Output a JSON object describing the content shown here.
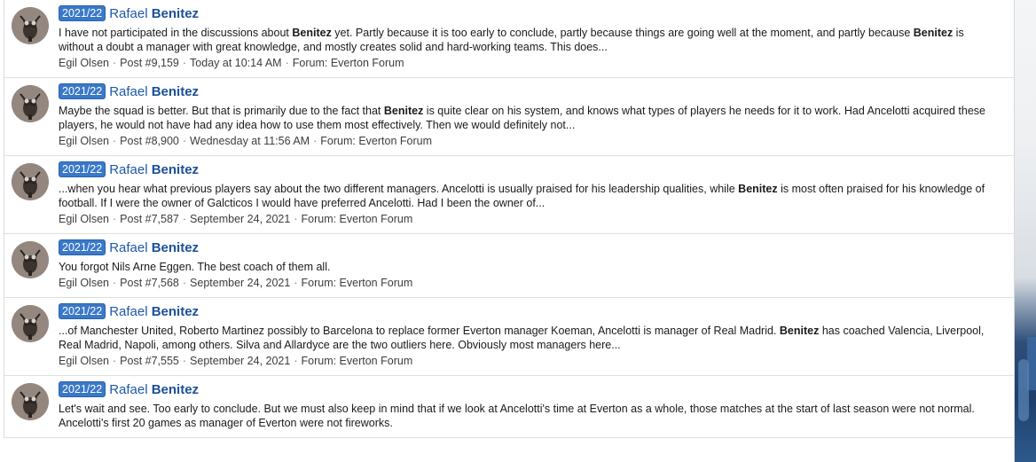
{
  "results": [
    {
      "prefix": "2021/22",
      "thread_plain": "Rafael ",
      "thread_bold": "Benitez",
      "snippet_parts": [
        {
          "t": "I have not participated in the discussions about "
        },
        {
          "b": "Benitez"
        },
        {
          "t": " yet. Partly because it is too early to conclude, partly because things are going well at the moment, and partly because "
        },
        {
          "b": "Benitez"
        },
        {
          "t": " is without a doubt a manager with great knowledge, and mostly creates solid and hard-working teams. This does..."
        }
      ],
      "author": "Egil Olsen",
      "post": "Post #9,159",
      "date": "Today at 10:14 AM",
      "forum": "Forum: Everton Forum"
    },
    {
      "prefix": "2021/22",
      "thread_plain": "Rafael ",
      "thread_bold": "Benitez",
      "snippet_parts": [
        {
          "t": "Maybe the squad is better. But that is primarily due to the fact that "
        },
        {
          "b": "Benitez"
        },
        {
          "t": " is quite clear on his system, and knows what types of players he needs for it to work. Had Ancelotti acquired these players, he would not have had any idea how to use them most effectively. Then we would definitely not..."
        }
      ],
      "author": "Egil Olsen",
      "post": "Post #8,900",
      "date": "Wednesday at 11:56 AM",
      "forum": "Forum: Everton Forum"
    },
    {
      "prefix": "2021/22",
      "thread_plain": "Rafael ",
      "thread_bold": "Benitez",
      "snippet_parts": [
        {
          "t": "...when you hear what previous players say about the two different managers. Ancelotti is usually praised for his leadership qualities, while "
        },
        {
          "b": "Benitez"
        },
        {
          "t": " is most often praised for his knowledge of football. If I were the owner of Galcticos I would have preferred Ancelotti. Had I been the owner of..."
        }
      ],
      "author": "Egil Olsen",
      "post": "Post #7,587",
      "date": "September 24, 2021",
      "forum": "Forum: Everton Forum"
    },
    {
      "prefix": "2021/22",
      "thread_plain": "Rafael ",
      "thread_bold": "Benitez",
      "snippet_parts": [
        {
          "t": "You forgot Nils Arne Eggen. The best coach of them all."
        }
      ],
      "author": "Egil Olsen",
      "post": "Post #7,568",
      "date": "September 24, 2021",
      "forum": "Forum: Everton Forum"
    },
    {
      "prefix": "2021/22",
      "thread_plain": "Rafael ",
      "thread_bold": "Benitez",
      "snippet_parts": [
        {
          "t": "...of Manchester United, Roberto Martinez possibly to Barcelona to replace former Everton manager Koeman, Ancelotti is manager of Real Madrid. "
        },
        {
          "b": "Benitez"
        },
        {
          "t": " has coached Valencia, Liverpool, Real Madrid, Napoli, among others. Silva and Allardyce are the two outliers here. Obviously most managers here..."
        }
      ],
      "author": "Egil Olsen",
      "post": "Post #7,555",
      "date": "September 24, 2021",
      "forum": "Forum: Everton Forum"
    },
    {
      "prefix": "2021/22",
      "thread_plain": "Rafael ",
      "thread_bold": "Benitez",
      "snippet_parts": [
        {
          "t": "Let's wait and see. Too early to conclude. But we must also keep in mind that if we look at Ancelotti's time at Everton as a whole, those matches at the start of last season were not normal. Ancelotti's first 20 games as manager of Everton were not fireworks."
        }
      ],
      "author": "",
      "post": "",
      "date": "",
      "forum": ""
    }
  ],
  "separator": "·",
  "colors": {
    "prefix_badge": "#3a78c9",
    "thread_link": "#1f58a8"
  },
  "icons": {
    "avatar": "owl-avatar-icon"
  }
}
